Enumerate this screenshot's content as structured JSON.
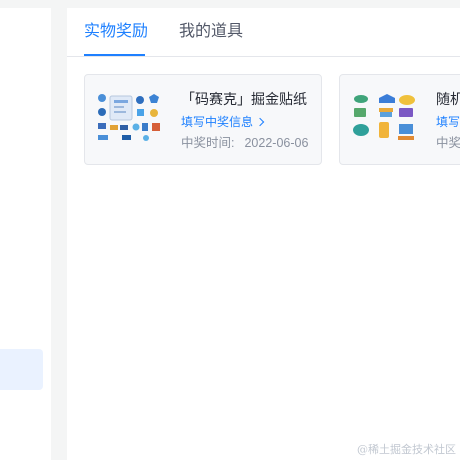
{
  "tabs": [
    {
      "label": "实物奖励",
      "active": true
    },
    {
      "label": "我的道具",
      "active": false
    }
  ],
  "prizes": [
    {
      "title": "「码赛克」掘金贴纸",
      "link_label": "填写中奖信息",
      "time_label": "中奖时间:",
      "time_value": "2022-06-06",
      "image": "sticker-pack-image"
    },
    {
      "title": "随机",
      "link_label": "填写",
      "time_label": "中奖",
      "time_value": "",
      "image": "random-prize-image"
    }
  ],
  "watermark": "@稀土掘金技术社区",
  "colors": {
    "accent": "#1e80ff",
    "text_primary": "#252933",
    "text_muted": "#8a919f",
    "background": "#f4f5f5"
  }
}
